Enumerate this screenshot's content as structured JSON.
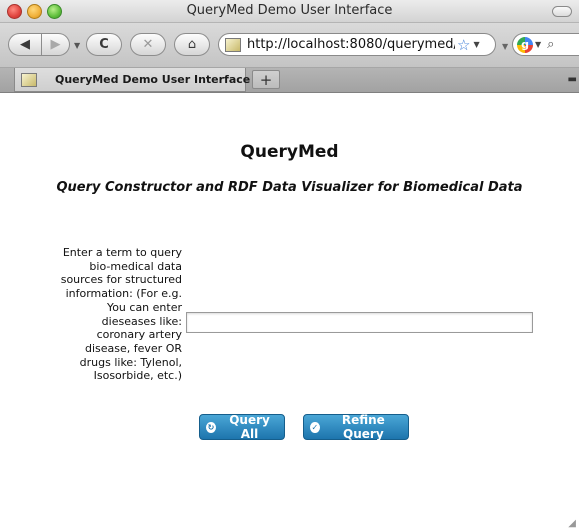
{
  "window": {
    "title": "QueryMed Demo User Interface"
  },
  "toolbar": {
    "back_icon": "back-arrow-icon",
    "forward_icon": "forward-arrow-icon",
    "reload_icon": "reload-icon",
    "stop_icon": "stop-icon",
    "home_icon": "home-icon",
    "url": "http://localhost:8080/querymed/",
    "bookmark_icon": "star-icon",
    "search_icon": "magnifier-icon"
  },
  "tabs": [
    {
      "label": "QueryMed Demo User Interface"
    }
  ],
  "page": {
    "title": "QueryMed",
    "subtitle": "Query Constructor and RDF Data Visualizer for Biomedical Data",
    "prompt": "Enter a term to query bio-medical data sources for structured information: (For e.g. You can enter dieseases like: coronary artery disease, fever OR drugs like: Tylenol, Isosorbide, etc.)",
    "query_input_value": "",
    "buttons": {
      "query_all": "Query All",
      "refine_query": "Refine Query"
    }
  },
  "colors": {
    "button_top": "#4aa6d6",
    "button_bottom": "#1d75ad"
  }
}
